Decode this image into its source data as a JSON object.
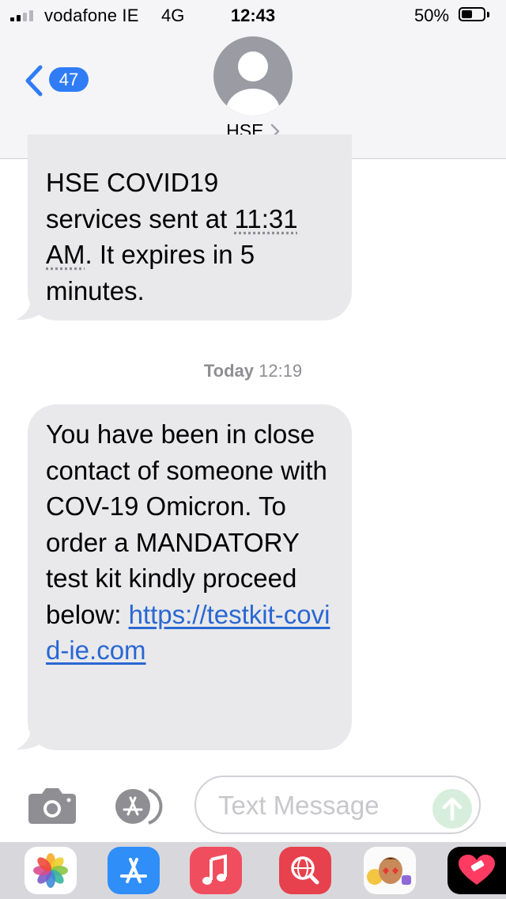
{
  "status_bar": {
    "carrier": "vodafone IE",
    "network": "4G",
    "time": "12:43",
    "battery_percent": "50%",
    "signal_bars": 2,
    "battery_level": 0.5
  },
  "header": {
    "unread_count": "47",
    "contact_name": "HSE"
  },
  "messages": {
    "first": {
      "line1": "HSE COVID19",
      "line2_pre": "services sent at ",
      "line2_time": "11:31",
      "line3_ampm": "AM",
      "line3_post": ". It expires in 5",
      "line4": "minutes."
    },
    "timestamp": {
      "day": "Today",
      "time": "12:19"
    },
    "second": {
      "body": "You have been in close contact of someone with COV-19 Omicron. To order a MANDATORY test kit kindly proceed below: ",
      "link": "https://testkit-covid-ie.com"
    }
  },
  "compose": {
    "placeholder": "Text Message"
  },
  "app_drawer": [
    "photos-app-icon",
    "app-store-icon",
    "music-icon",
    "web-search-icon",
    "memoji-icon",
    "digital-touch-icon"
  ],
  "colors": {
    "accent_blue": "#2f7cf6",
    "bubble_gray": "#e9e9eb",
    "link_blue": "#2a67d3",
    "send_green_disabled": "#d7eedc"
  }
}
